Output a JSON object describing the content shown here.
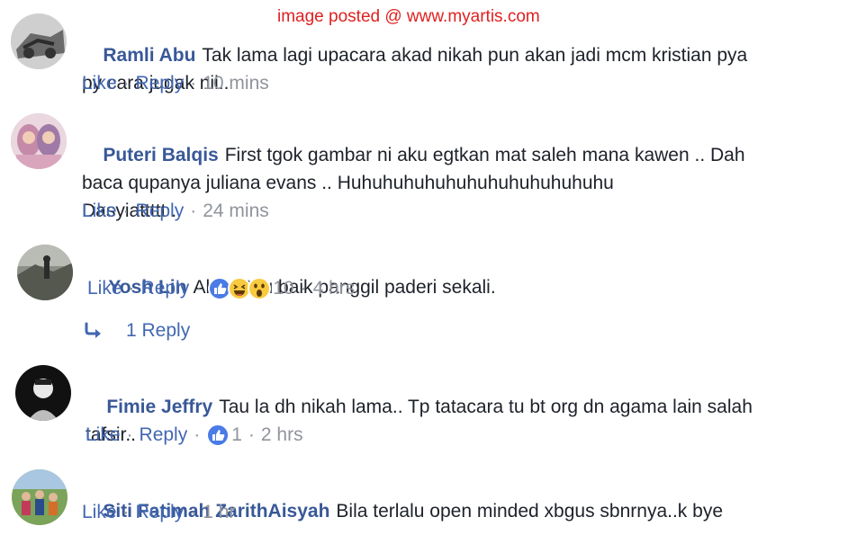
{
  "watermark": "image posted @ www.myartis.com",
  "comments": [
    {
      "name": "Ramli Abu",
      "text": "Tak lama lagi upacara akad nikah pun akan jadi mcm kristian pya\npy cara jugak nii..",
      "like": "Like",
      "reply": "Reply",
      "time": "10 mins"
    },
    {
      "name": "Puteri Balqis",
      "text": "First tgok gambar ni aku egtkan mat saleh mana kawen .. Dah\nbaca qupanya juliana evans .. Huhuhuhuhuhuhuhuhuhuhuhuhu\nDasyiattttt .",
      "like": "Like",
      "reply": "Reply",
      "time": "24 mins"
    },
    {
      "name": "Yosh Lin",
      "text": "Alang2 tu baik panggil paderi sekali.",
      "like": "Like",
      "reply": "Reply",
      "reaction_count": "10",
      "reaction_icons": [
        "like-reaction-icon",
        "haha-reaction-icon",
        "wow-reaction-icon"
      ],
      "time": "4 hrs",
      "replies_label": "1 Reply"
    },
    {
      "name": "Fimie Jeffry",
      "text": "Tau la dh nikah lama.. Tp tatacara tu bt org dn agama lain salah\ntafsir..",
      "like": "Like",
      "reply": "Reply",
      "reaction_count": "1",
      "reaction_icons": [
        "like-reaction-icon"
      ],
      "time": "2 hrs"
    },
    {
      "name": "Siti Fatimah ZarithAisyah",
      "text": "Bila terlalu open minded xbgus sbnrnya..k bye",
      "like": "Like",
      "reply": "Reply",
      "time": "1 hr"
    }
  ],
  "colors": {
    "name": "#385898",
    "link": "#4267b2",
    "meta": "#90949c",
    "text": "#1d2129",
    "watermark": "#e02020"
  }
}
